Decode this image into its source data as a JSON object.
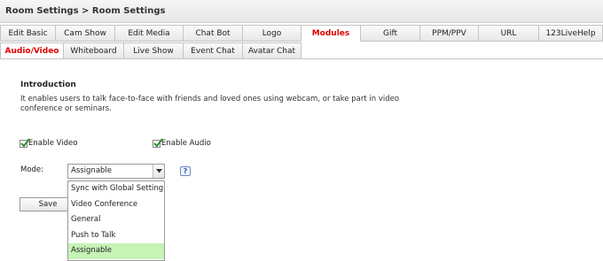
{
  "breadcrumb": "Room Settings  > Room Settings",
  "tabs_row1": [
    {
      "label": "Edit Basic",
      "active": false
    },
    {
      "label": "Cam Show",
      "active": false
    },
    {
      "label": "Edit Media",
      "active": false
    },
    {
      "label": "Chat Bot",
      "active": false
    },
    {
      "label": "Logo",
      "active": false
    },
    {
      "label": "Modules",
      "active": true
    },
    {
      "label": "Gift",
      "active": false
    },
    {
      "label": "PPM/PPV",
      "active": false
    },
    {
      "label": "URL",
      "active": false
    },
    {
      "label": "123LiveHelp",
      "active": false
    }
  ],
  "tabs_row2": [
    {
      "label": "Audio/Video",
      "active": true
    },
    {
      "label": "Whiteboard",
      "active": false
    },
    {
      "label": "Live Show",
      "active": false
    },
    {
      "label": "Event Chat",
      "active": false
    },
    {
      "label": "Avatar Chat",
      "active": false
    }
  ],
  "intro": {
    "title": "Introduction",
    "text": "It enables users to talk face-to-face with friends and loved ones using webcam, or take part in video conference or seminars."
  },
  "options": {
    "enable_video": {
      "label": "Enable Video",
      "checked": true
    },
    "enable_audio": {
      "label": "Enable Audio",
      "checked": true
    }
  },
  "mode": {
    "label": "Mode:",
    "selected": "Assignable",
    "help": "?",
    "options": [
      "Sync with Global Setting",
      "Video Conference",
      "General",
      "Push to Talk",
      "Assignable"
    ]
  },
  "save_label": "Save",
  "colors": {
    "active_tab": "#e00000",
    "selected_option": "#c6f3b6",
    "check": "#2f8f2f"
  }
}
